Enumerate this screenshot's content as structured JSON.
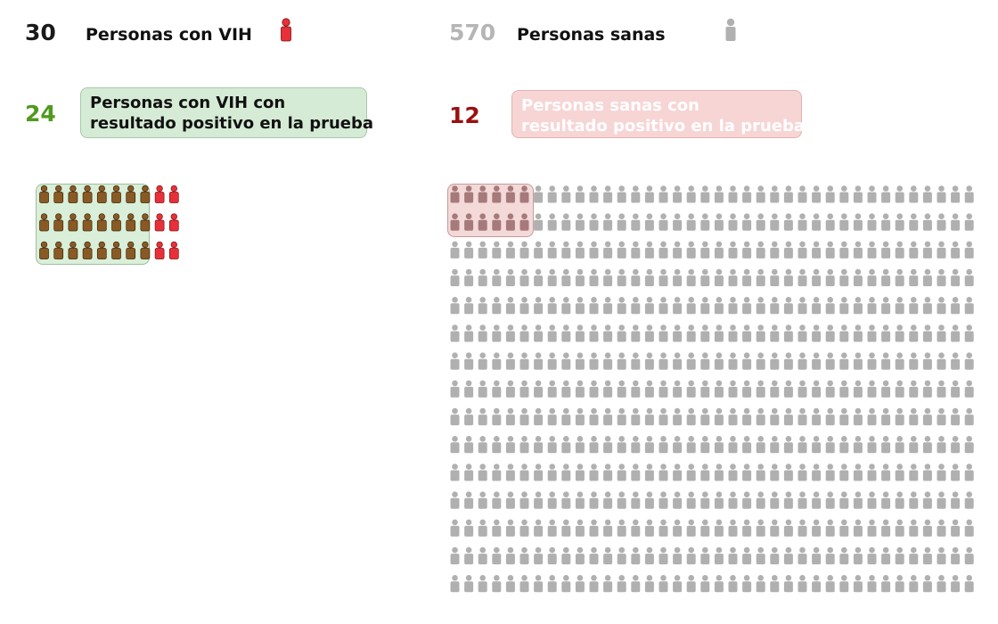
{
  "hiv": {
    "count": "30",
    "label": "Personas con VIH",
    "positive_count": "24",
    "positive_label_line1": "Personas con VIH con",
    "positive_label_line2": "resultado positivo en la prueba"
  },
  "healthy": {
    "count": "570",
    "label": "Personas sanas",
    "positive_count": "12",
    "positive_label_line1": "Personas sanas con",
    "positive_label_line2": "resultado positivo en la prueba"
  },
  "chart_data": {
    "type": "pictogram",
    "groups": [
      {
        "total": 30,
        "highlighted": 24
      },
      {
        "total": 570,
        "highlighted": 12
      }
    ]
  },
  "colors": {
    "hiv": "#e8303a",
    "hiv_positive": "#8a5a24",
    "healthy": "#b0b0b0",
    "healthy_positive": "#a67a7a",
    "hiv_count_color": "#1a1a1a",
    "healthy_count_color": "#b5b5b5",
    "hiv_positive_count_color": "#4f9a1f",
    "healthy_positive_count_color": "#9a1010"
  }
}
